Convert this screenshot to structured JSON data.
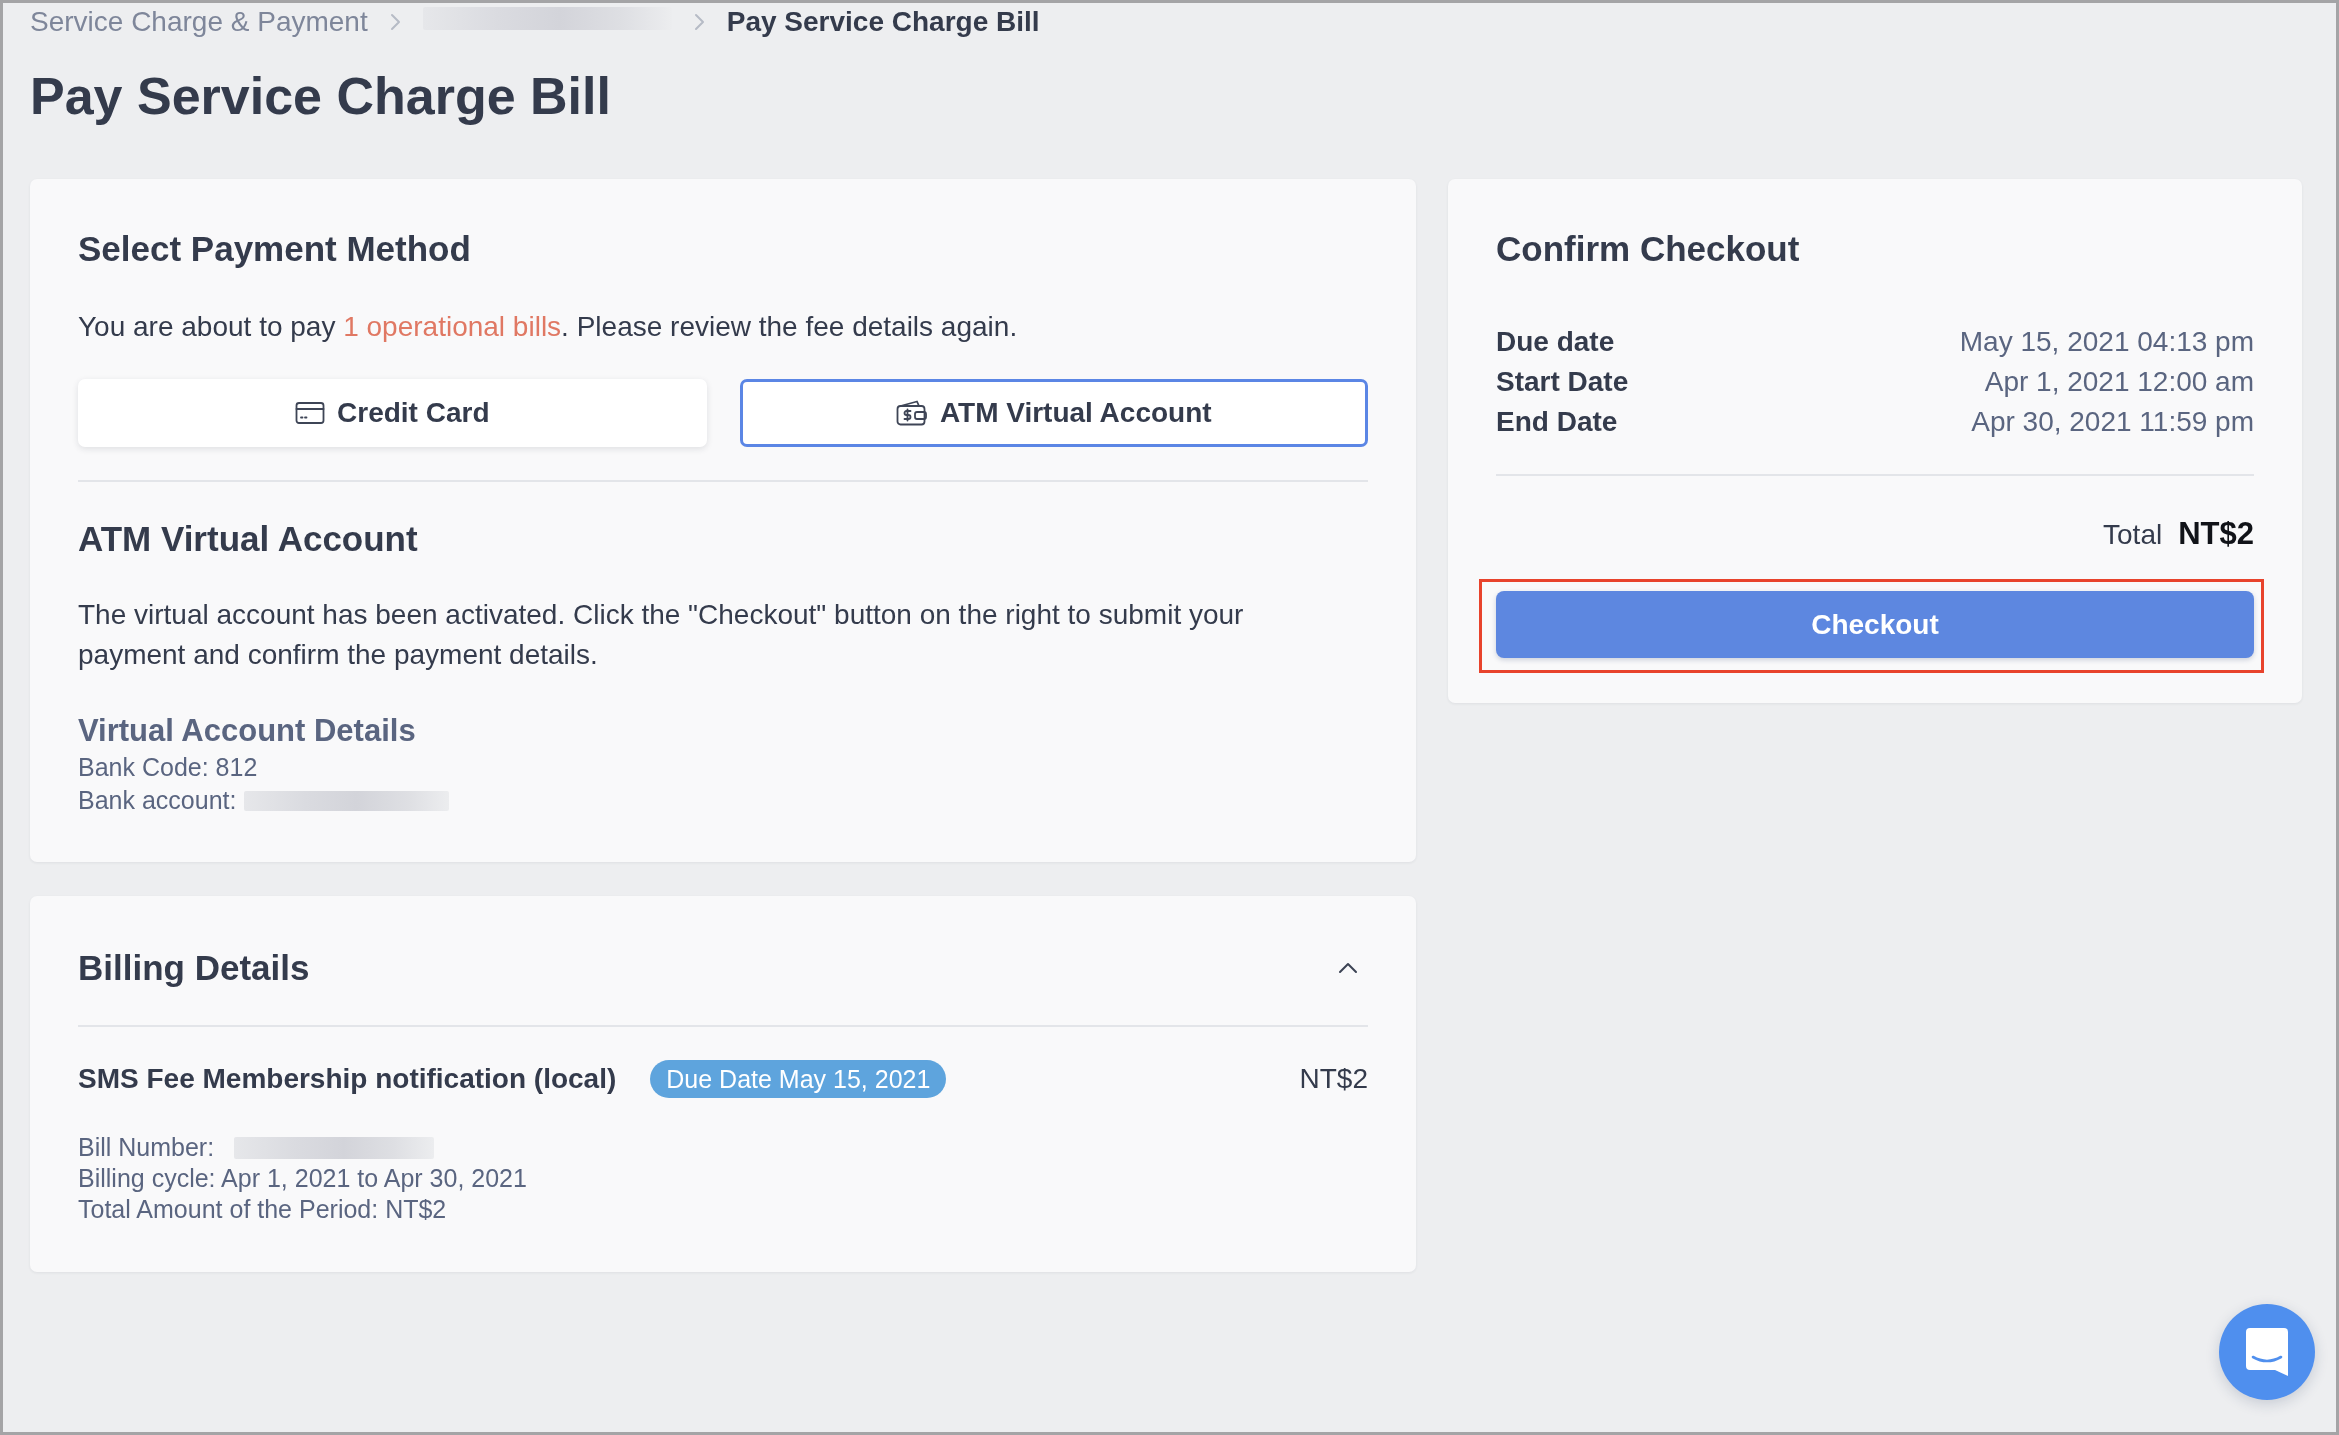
{
  "breadcrumb": [
    {
      "kind": "link",
      "label": "Service Charge & Payment"
    },
    {
      "kind": "blurred"
    },
    {
      "kind": "current",
      "label": "Pay Service Charge Bill"
    }
  ],
  "page_title": "Pay Service Charge Bill",
  "payment": {
    "title": "Select Payment Method",
    "intro": {
      "before": "You are about to pay ",
      "link": "1 operational bills",
      "after": ". Please review the fee details again."
    },
    "methods": [
      {
        "kind": "card",
        "label": "Credit Card",
        "selected": false
      },
      {
        "kind": "atm",
        "label": "ATM Virtual Account",
        "selected": true
      }
    ],
    "section": {
      "title": "ATM Virtual Account",
      "text": "The virtual account has been activated. Click the \"Checkout\" button on the right to submit your payment and confirm the payment details.",
      "details_title": "Virtual Account Details",
      "details": [
        {
          "text": "Bank Code: 812",
          "redacted": false
        },
        {
          "text": "Bank account:",
          "redacted": true
        }
      ]
    }
  },
  "checkout": {
    "title": "Confirm Checkout",
    "rows": [
      {
        "label": "Due date",
        "value": "May 15, 2021 04:13 pm"
      },
      {
        "label": "Start Date",
        "value": "Apr 1, 2021 12:00 am"
      },
      {
        "label": "End Date",
        "value": "Apr 30, 2021 11:59 pm"
      }
    ],
    "total_label": "Total",
    "total_value": "NT$2",
    "button": {
      "label": "Checkout",
      "highlighted": true
    }
  },
  "billing": {
    "title": "Billing Details",
    "expanded": true,
    "items": [
      {
        "name": "SMS Fee Membership notification (local)",
        "badge": "Due Date May 15, 2021",
        "amount": "NT$2",
        "lines": [
          {
            "text": "Bill Number:",
            "redacted": true
          },
          {
            "text": "Billing cycle: Apr 1, 2021 to Apr 30, 2021",
            "redacted": false
          },
          {
            "text": "Total Amount of the Period: NT$2",
            "redacted": false
          }
        ]
      }
    ]
  }
}
